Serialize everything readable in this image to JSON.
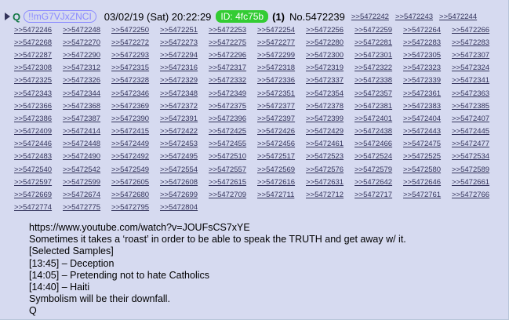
{
  "post": {
    "name": "Q",
    "tripcode": "!!mG7VJxZNCI",
    "date": "03/02/19 (Sat) 20:22:29",
    "id_label": "ID: 4fc75b",
    "reply_count": "(1)",
    "post_number": "No.5472239",
    "header_replies": [
      ">>5472242",
      ">>5472243",
      ">>5472244"
    ],
    "replies": [
      ">>5472246",
      ">>5472248",
      ">>5472250",
      ">>5472251",
      ">>5472253",
      ">>5472254",
      ">>5472256",
      ">>5472259",
      ">>5472264",
      ">>5472266",
      ">>5472268",
      ">>5472270",
      ">>5472272",
      ">>5472273",
      ">>5472275",
      ">>5472277",
      ">>5472280",
      ">>5472281",
      ">>5472283",
      ">>5472283",
      ">>5472287",
      ">>5472290",
      ">>5472293",
      ">>5472294",
      ">>5472296",
      ">>5472299",
      ">>5472300",
      ">>5472301",
      ">>5472305",
      ">>5472307",
      ">>5472308",
      ">>5472312",
      ">>5472315",
      ">>5472316",
      ">>5472317",
      ">>5472318",
      ">>5472319",
      ">>5472322",
      ">>5472323",
      ">>5472324",
      ">>5472325",
      ">>5472326",
      ">>5472328",
      ">>5472329",
      ">>5472332",
      ">>5472336",
      ">>5472337",
      ">>5472338",
      ">>5472339",
      ">>5472341",
      ">>5472343",
      ">>5472344",
      ">>5472346",
      ">>5472348",
      ">>5472349",
      ">>5472351",
      ">>5472354",
      ">>5472357",
      ">>5472361",
      ">>5472363",
      ">>5472366",
      ">>5472368",
      ">>5472369",
      ">>5472372",
      ">>5472375",
      ">>5472377",
      ">>5472378",
      ">>5472381",
      ">>5472383",
      ">>5472385",
      ">>5472386",
      ">>5472387",
      ">>5472390",
      ">>5472391",
      ">>5472396",
      ">>5472397",
      ">>5472399",
      ">>5472401",
      ">>5472404",
      ">>5472407",
      ">>5472409",
      ">>5472414",
      ">>5472415",
      ">>5472422",
      ">>5472425",
      ">>5472426",
      ">>5472429",
      ">>5472438",
      ">>5472443",
      ">>5472445",
      ">>5472446",
      ">>5472448",
      ">>5472449",
      ">>5472453",
      ">>5472455",
      ">>5472456",
      ">>5472461",
      ">>5472466",
      ">>5472475",
      ">>5472477",
      ">>5472483",
      ">>5472490",
      ">>5472492",
      ">>5472495",
      ">>5472510",
      ">>5472517",
      ">>5472523",
      ">>5472524",
      ">>5472525",
      ">>5472534",
      ">>5472540",
      ">>5472542",
      ">>5472549",
      ">>5472554",
      ">>5472557",
      ">>5472569",
      ">>5472576",
      ">>5472579",
      ">>5472580",
      ">>5472589",
      ">>5472597",
      ">>5472599",
      ">>5472605",
      ">>5472608",
      ">>5472615",
      ">>5472616",
      ">>5472631",
      ">>5472642",
      ">>5472646",
      ">>5472661",
      ">>5472669",
      ">>5472674",
      ">>5472680",
      ">>5472699",
      ">>5472709",
      ">>5472711",
      ">>5472712",
      ">>5472717",
      ">>5472761",
      ">>5472766",
      ">>5472774",
      ">>5472775",
      ">>5472795",
      ">>5472804"
    ],
    "body_lines": [
      "https://www.youtube.com/watch?v=JOUFsCS7xYE",
      "Sometimes it takes a ‘roast’ in order to be able to speak the TRUTH and get away w/ it.",
      "[Selected Samples]",
      "[13:45] – Deception",
      "[14:05] – Pretending not to hate Catholics",
      "[14:40] – Haiti",
      "Symbolism will be their downfall.",
      "Q"
    ]
  },
  "colors": {
    "background": "#d6daf0",
    "name": "#117743",
    "link": "#34345c",
    "id_badge": "#33cc33",
    "tripcode": "#8a8aff"
  }
}
